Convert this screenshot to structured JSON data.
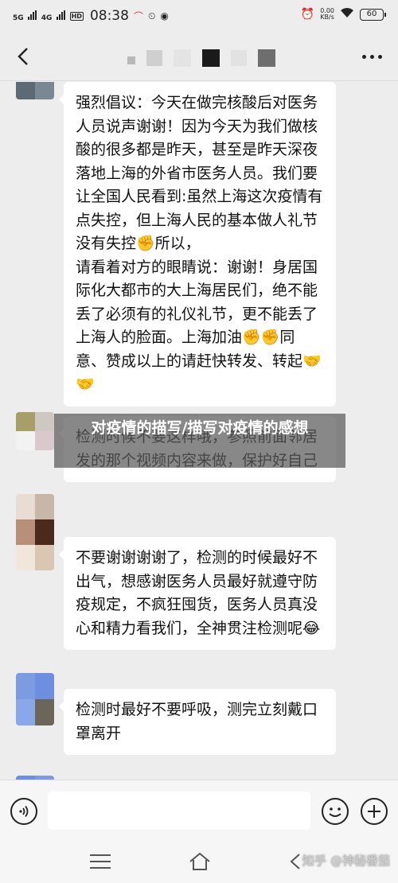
{
  "status_bar": {
    "signal_1": "5G",
    "signal_2": "4G",
    "hd": "HD",
    "time": "08:38",
    "net_speed_value": "0.00",
    "net_speed_unit": "KB/s",
    "battery": "60"
  },
  "messages": [
    {
      "text": "强烈倡议：今天在做完核酸后对医务人员说声谢谢！因为今天为我们做核酸的很多都是昨天，甚至是昨天深夜落地上海的外省市医务人员。我们要让全国人民看到:虽然上海这次疫情有点失控，但上海人民的基本做人礼节没有失控✊所以，\n请看着对方的眼睛说：谢谢！身居国际化大都市的大上海居民们，绝不能丢了必须有的礼仪礼节，更不能丢了上海人的脸面。上海加油✊✊同意、赞成以上的请赶快转发、转起🤝🤝"
    },
    {
      "text": "检测时候不要这样哦，参照前面邻居发的那个视频内容来做，保护好自己"
    },
    {
      "text": "不要谢谢谢谢了，检测的时候最好不出气，想感谢医务人员最好就遵守防疫规定，不疯狂囤货，医务人员真没心和精力看我们，全神贯注检测呢😂"
    },
    {
      "text": "检测时最好不要呼吸，测完立刻戴口罩离开"
    }
  ],
  "overlay_banner": {
    "text": "对疫情的描写/描写对疫情的感想"
  },
  "watermark": "知乎 @神秘番茄",
  "icons": {
    "back": "chevron-left-icon",
    "more": "more-dots-icon",
    "voice": "voice-icon",
    "emoji": "emoji-icon",
    "plus": "plus-icon",
    "menu": "menu-icon",
    "home": "home-icon",
    "nav_back": "nav-back-icon"
  }
}
